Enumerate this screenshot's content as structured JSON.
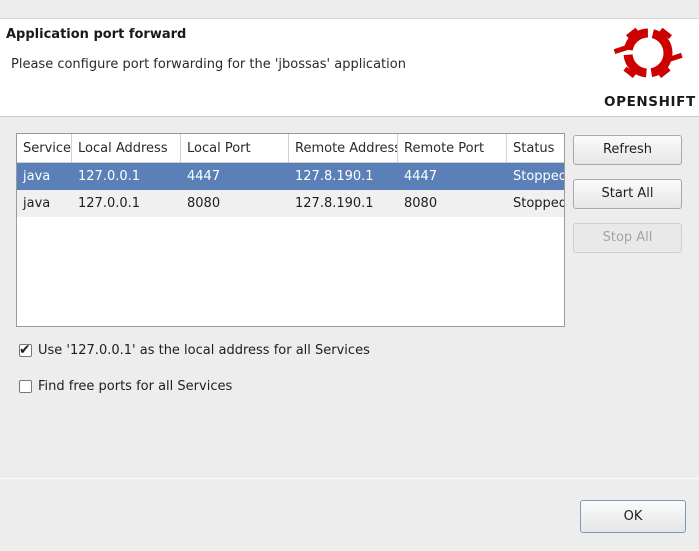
{
  "header": {
    "title": "Application port forward",
    "description": "Please configure port forwarding for the 'jbossas' application",
    "logo_text": "OPENSHIFT",
    "logo_color": "#cc0000",
    "logo_icon": "openshift-gear-icon"
  },
  "table": {
    "columns": [
      "Service",
      "Local Address",
      "Local Port",
      "Remote Address",
      "Remote Port",
      "Status"
    ],
    "rows": [
      {
        "service": "java",
        "local_address": "127.0.0.1",
        "local_port": "4447",
        "remote_address": "127.8.190.1",
        "remote_port": "4447",
        "status": "Stopped",
        "selected": true
      },
      {
        "service": "java",
        "local_address": "127.0.0.1",
        "local_port": "8080",
        "remote_address": "127.8.190.1",
        "remote_port": "8080",
        "status": "Stopped",
        "selected": false
      }
    ],
    "selection_color": "#5b7fb7"
  },
  "buttons": {
    "refresh": "Refresh",
    "start_all": "Start All",
    "stop_all": "Stop All",
    "ok": "OK"
  },
  "options": {
    "use_local_address": {
      "label": "Use '127.0.0.1' as the local address for all Services",
      "checked": true
    },
    "find_free_ports": {
      "label": "Find free ports for all Services",
      "checked": false
    }
  }
}
